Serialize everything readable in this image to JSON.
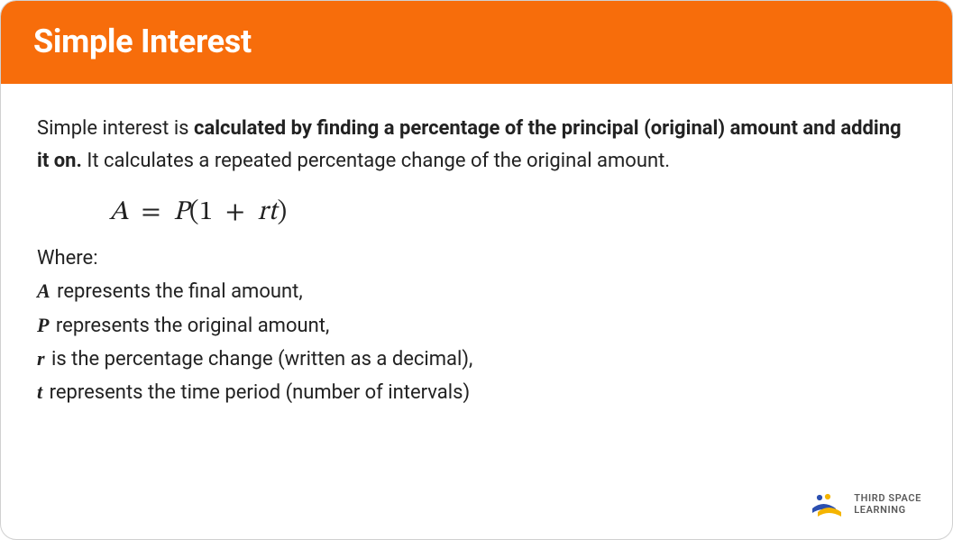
{
  "header": {
    "title": "Simple Interest"
  },
  "intro": {
    "lead": "Simple interest is ",
    "bold": "calculated by finding a percentage of the principal (original) amount and adding it on.",
    "tail": " It calculates a repeated percentage change of the original amount."
  },
  "formula": {
    "A": "A",
    "eq": "=",
    "P": "P",
    "open": "(",
    "one": "1",
    "plus": " + ",
    "r": "r",
    "t": "t",
    "close": ")"
  },
  "defs": {
    "where": "Where:",
    "items": [
      {
        "var": "A",
        "text": " represents the final amount,"
      },
      {
        "var": "P",
        "text": " represents the original amount,"
      },
      {
        "var": "r",
        "text": " is the percentage change (written as a decimal),"
      },
      {
        "var": "t",
        "text": " represents the time period (number of intervals)"
      }
    ]
  },
  "brand": {
    "line1": "THIRD SPACE",
    "line2": "LEARNING"
  }
}
